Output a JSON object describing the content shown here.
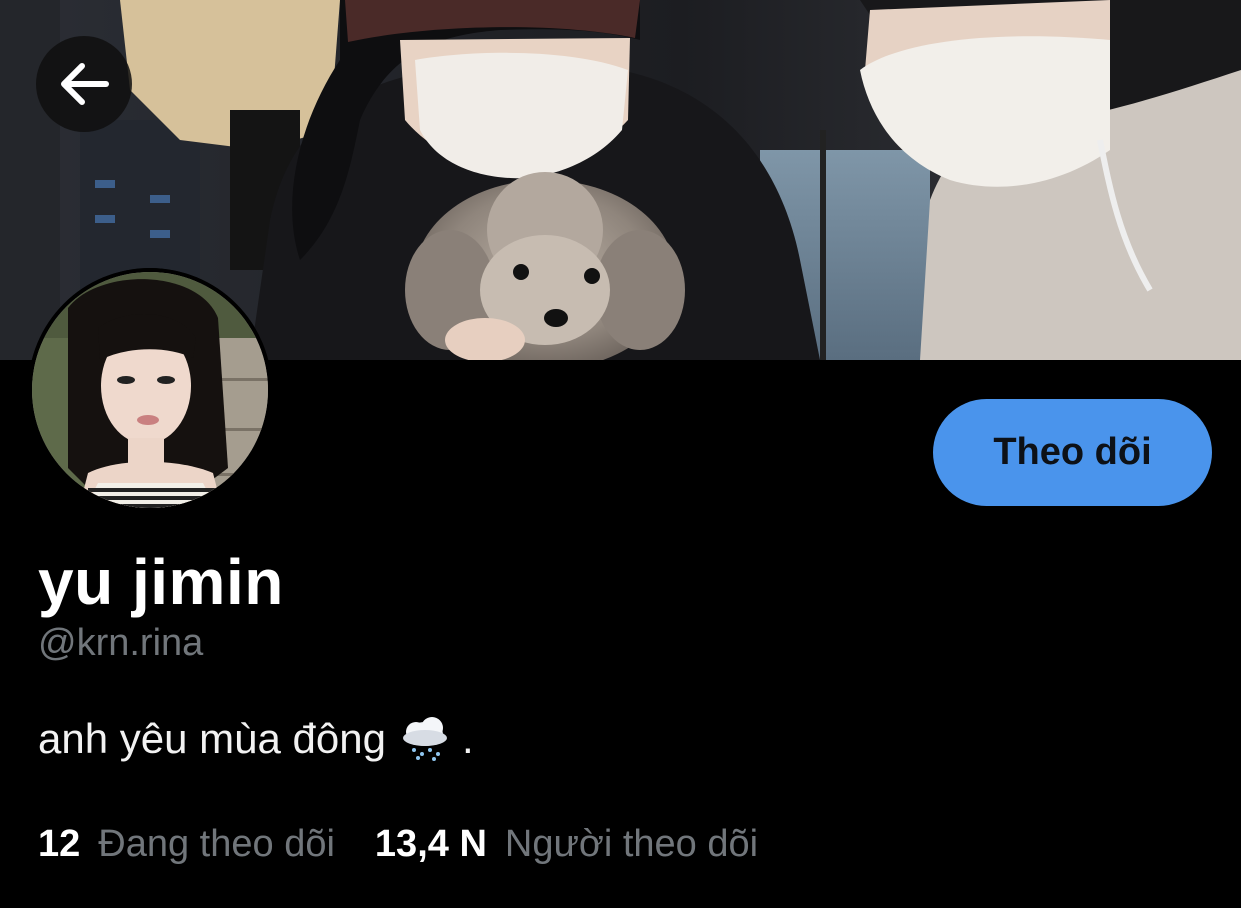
{
  "header": {
    "back_icon": "arrow-left-icon",
    "banner_image": "banner-photo"
  },
  "profile": {
    "avatar_image": "avatar-photo",
    "display_name": "yu jimin",
    "handle": "@krn.rina",
    "bio_text": "anh yêu mùa đông",
    "bio_emoji": "cloud-snow-icon",
    "bio_suffix": "."
  },
  "actions": {
    "follow_label": "Theo dõi"
  },
  "stats": {
    "following_count": "12",
    "following_label": "Đang theo dõi",
    "followers_count": "13,4 N",
    "followers_label": "Người theo dõi"
  },
  "colors": {
    "background": "#000000",
    "follow_button": "#4a94ec",
    "secondary_text": "#71767b",
    "primary_text": "#ffffff"
  }
}
